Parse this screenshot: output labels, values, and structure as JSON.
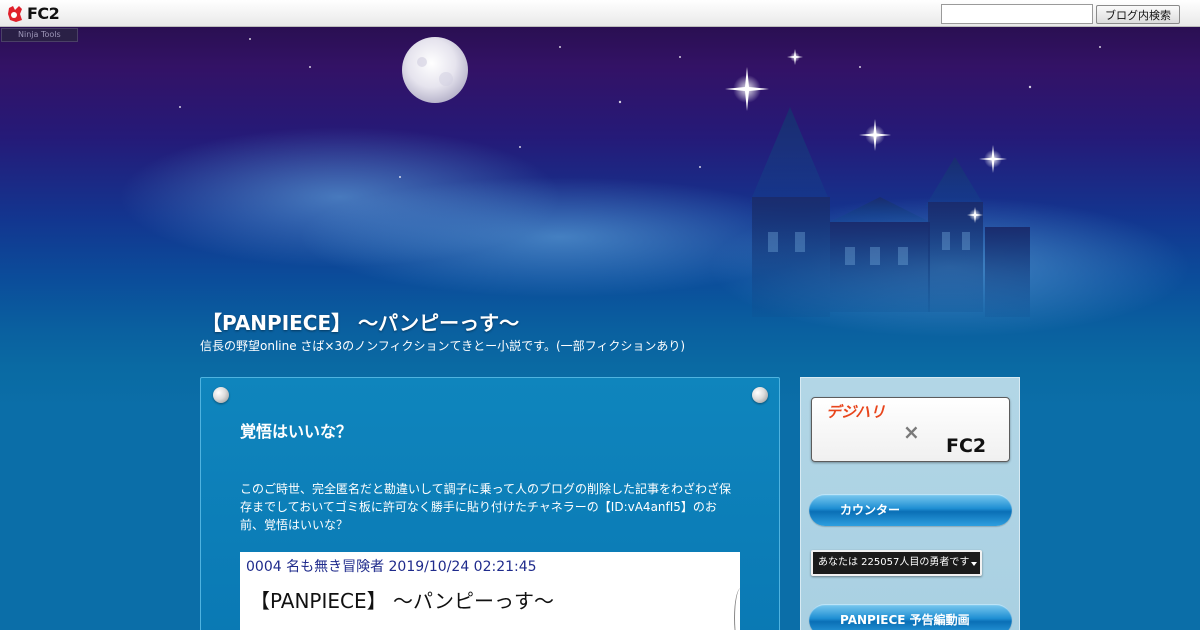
{
  "toolbar": {
    "brand": "FC2",
    "search_value": "",
    "search_button_label": "ブログ内検索"
  },
  "ninja_tools": "Ninja Tools",
  "blog": {
    "title": "【PANPIECE】 ～パンピーっす～",
    "description": "信長の野望online さば×3のノンフィクションてきとー小説です。(一部フィクションあり)"
  },
  "post": {
    "title": "覚悟はいいな？",
    "body": "このご時世、完全匿名だと勘違いして調子に乗って人のブログの削除した記事をわざわざ保存までしておいてゴミ板に許可なく勝手に貼り付けたチャネラーの【ID:vA4anfI5】のお前、覚悟はいいな？",
    "image": {
      "meta": "0004 名も無き冒険者 2019/10/24 02:21:45",
      "text": "【PANPIECE】 ～パンピーっす～"
    }
  },
  "sidebar": {
    "banner": {
      "left": "デジハリ",
      "cross": "×",
      "right": "FC2"
    },
    "counter_heading": "カウンター",
    "counter_text": "あなたは 225057人目の勇者です",
    "trailer_heading": "PANPIECE 予告編動画"
  },
  "colors": {
    "accent_blue": "#0b6ea8",
    "header_purple": "#2a0f52",
    "sidebar_bg": "#b2d6e6"
  }
}
